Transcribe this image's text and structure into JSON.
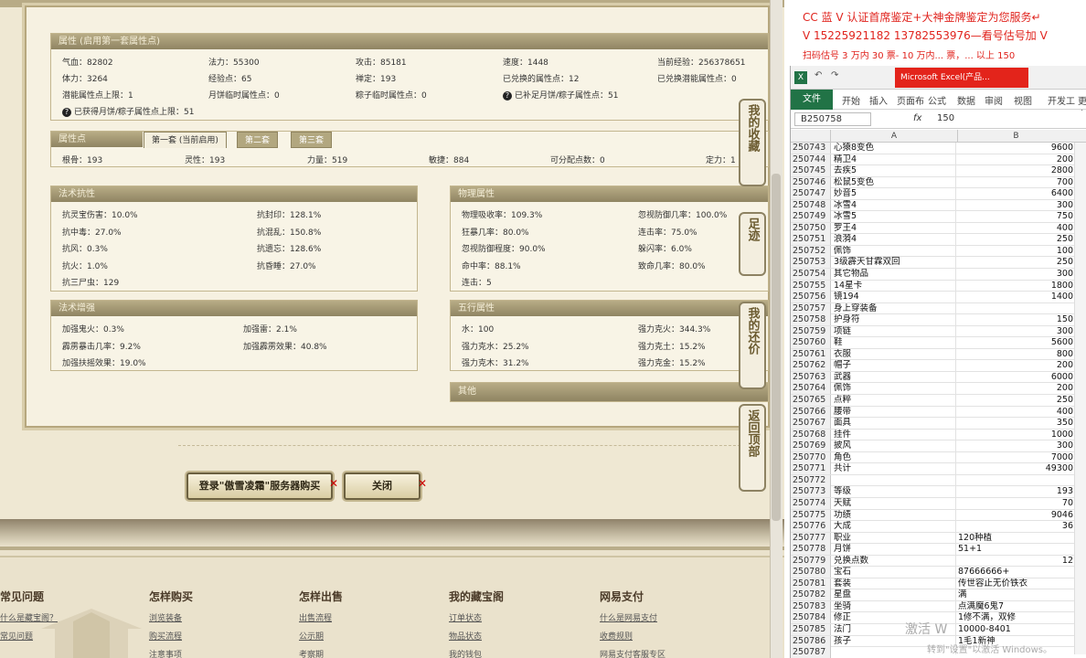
{
  "attr_panel": {
    "title": "属性 (启用第一套属性点)",
    "rows": [
      [
        "气血：82802",
        "法力：55300",
        "攻击：85181",
        "速度：1448",
        "当前经验：256378651"
      ],
      [
        "体力：3264",
        "经验点：65",
        "禅定：193",
        "已兑换的属性点：12",
        "已兑换潜能属性点：0"
      ],
      [
        "潜能属性点上限：1",
        "月饼临时属性点：0",
        "粽子临时属性点：0",
        "已补足月饼/粽子属性点：51",
        ""
      ]
    ],
    "note": "已获得月饼/粽子属性点上限：51",
    "help_icon": "question-icon"
  },
  "points_panel": {
    "title": "属性点",
    "tabs": [
      "第一套 (当前启用)",
      "第二套",
      "第三套"
    ],
    "values": [
      "根骨：193",
      "灵性：193",
      "力量：519",
      "敏捷：884",
      "可分配点数：0",
      "定力：1"
    ]
  },
  "magic_resist": {
    "title": "法术抗性",
    "left": [
      "抗灵宝伤害：10.0%",
      "抗中毒：27.0%",
      "抗风：0.3%",
      "抗火：1.0%",
      "抗三尸虫：129"
    ],
    "right": [
      "抗封印：128.1%",
      "抗混乱：150.8%",
      "抗遗忘：128.6%",
      "抗昏睡：27.0%"
    ]
  },
  "physical": {
    "title": "物理属性",
    "left": [
      "物理吸收率：109.3%",
      "狂暴几率：80.0%",
      "忽视防御程度：90.0%",
      "命中率：88.1%",
      "连击：5"
    ],
    "right": [
      "忽视防御几率：100.0%",
      "连击率：75.0%",
      "躲闪率：6.0%",
      "致命几率：80.0%"
    ]
  },
  "magic_boost": {
    "title": "法术增强",
    "left": [
      "加强鬼火：0.3%",
      "霹雳暴击几率：9.2%",
      "加强扶摇效果：19.0%"
    ],
    "right": [
      "加强雷：2.1%",
      "加强霹雳效果：40.8%"
    ]
  },
  "five_elements": {
    "title": "五行属性",
    "left": [
      "水：100",
      "强力克水：25.2%",
      "强力克木：31.2%"
    ],
    "right": [
      "强力克火：344.3%",
      "强力克土：15.2%",
      "强力克金：15.2%"
    ]
  },
  "other_panel": {
    "title": "其他"
  },
  "side_tabs": [
    "我的收藏",
    "足迹",
    "我的还价",
    "返回顶部"
  ],
  "buttons": {
    "login": "登录\"傲雪凌霜\"服务器购买",
    "close": "关闭"
  },
  "footer": {
    "columns": [
      {
        "title": "常见问题",
        "links": [
          "什么是藏宝阁？",
          "常见问题"
        ]
      },
      {
        "title": "怎样购买",
        "links": [
          "浏览装备",
          "购买流程",
          "注意事项"
        ]
      },
      {
        "title": "怎样出售",
        "links": [
          "出售流程",
          "公示期",
          "考察期"
        ]
      },
      {
        "title": "我的藏宝阁",
        "links": [
          "订单状态",
          "物品状态",
          "我的钱包"
        ]
      },
      {
        "title": "网易支付",
        "links": [
          "什么是网易支付",
          "收费规则",
          "网易支付客服专区"
        ]
      }
    ]
  },
  "ad": {
    "lines": [
      "CC 蓝 V 认证首席鉴定+大神金牌鉴定为您服务↵",
      "V 15225921182    13782553976—看号估号加 V",
      "扫码估号 3 万内 30 票- 10 万内... 票，... 以上 150"
    ],
    "colors": {
      "text": "#e0231d"
    }
  },
  "excel": {
    "title": "Microsoft Excel(产品...",
    "menu": [
      "文件",
      "开始",
      "插入",
      "页面布",
      "公式",
      "数据",
      "审阅",
      "视图",
      "开发工",
      "更多"
    ],
    "namebox": "B250758",
    "formula_value": "150",
    "columns": [
      "A",
      "B"
    ],
    "rows": [
      [
        "250743",
        "心猿8变色",
        "9600"
      ],
      [
        "250744",
        "精卫4",
        "200"
      ],
      [
        "250745",
        "去疾5",
        "2800"
      ],
      [
        "250746",
        "松鼠5变色",
        "700"
      ],
      [
        "250747",
        "妙音5",
        "6400"
      ],
      [
        "250748",
        "冰雪4",
        "300"
      ],
      [
        "250749",
        "冰雪5",
        "750"
      ],
      [
        "250750",
        "罗王4",
        "400"
      ],
      [
        "250751",
        "浪漪4",
        "250"
      ],
      [
        "250752",
        "佩饰",
        "100"
      ],
      [
        "250753",
        "3级霹天甘霖双回",
        "250"
      ],
      [
        "250754",
        "其它物品",
        "300"
      ],
      [
        "250755",
        "14星卡",
        "1800"
      ],
      [
        "250756",
        "镜194",
        "1400"
      ],
      [
        "250757",
        "身上穿装备",
        ""
      ],
      [
        "250758",
        "护身符",
        "150"
      ],
      [
        "250759",
        "项链",
        "300"
      ],
      [
        "250760",
        "鞋",
        "5600"
      ],
      [
        "250761",
        "衣服",
        "800"
      ],
      [
        "250762",
        "帽子",
        "200"
      ],
      [
        "250763",
        "武器",
        "6000"
      ],
      [
        "250764",
        "佩饰",
        "200"
      ],
      [
        "250765",
        "点粹",
        "250"
      ],
      [
        "250766",
        "腰带",
        "400"
      ],
      [
        "250767",
        "面具",
        "350"
      ],
      [
        "250768",
        "挂件",
        "1000"
      ],
      [
        "250769",
        "披风",
        "300"
      ],
      [
        "250770",
        "角色",
        "7000"
      ],
      [
        "250771",
        "共计",
        "49300"
      ],
      [
        "250772",
        "",
        ""
      ],
      [
        "250773",
        "等级",
        "193"
      ],
      [
        "250774",
        "天赋",
        "70"
      ],
      [
        "250775",
        "功绩",
        "9046"
      ],
      [
        "250776",
        "大成",
        "36"
      ],
      [
        "250777",
        "职业",
        "120种植"
      ],
      [
        "250778",
        "月饼",
        "51+1"
      ],
      [
        "250779",
        "兑换点数",
        "12"
      ],
      [
        "250780",
        "宝石",
        "87666666+"
      ],
      [
        "250781",
        "套装",
        "传世容止无价铁衣"
      ],
      [
        "250782",
        "星盘",
        "满"
      ],
      [
        "250783",
        "坐骑",
        "点满魔6鬼7"
      ],
      [
        "250784",
        "修正",
        "1修不满，双修"
      ],
      [
        "250785",
        "法门",
        "10000-8401"
      ],
      [
        "250786",
        "孩子",
        "1毛1新神"
      ],
      [
        "250787",
        "",
        ""
      ]
    ],
    "left_aligned_from": "250777"
  },
  "watermark": {
    "line1": "激活 W",
    "line2": "转到\"设置\"以激活 Windows。"
  }
}
